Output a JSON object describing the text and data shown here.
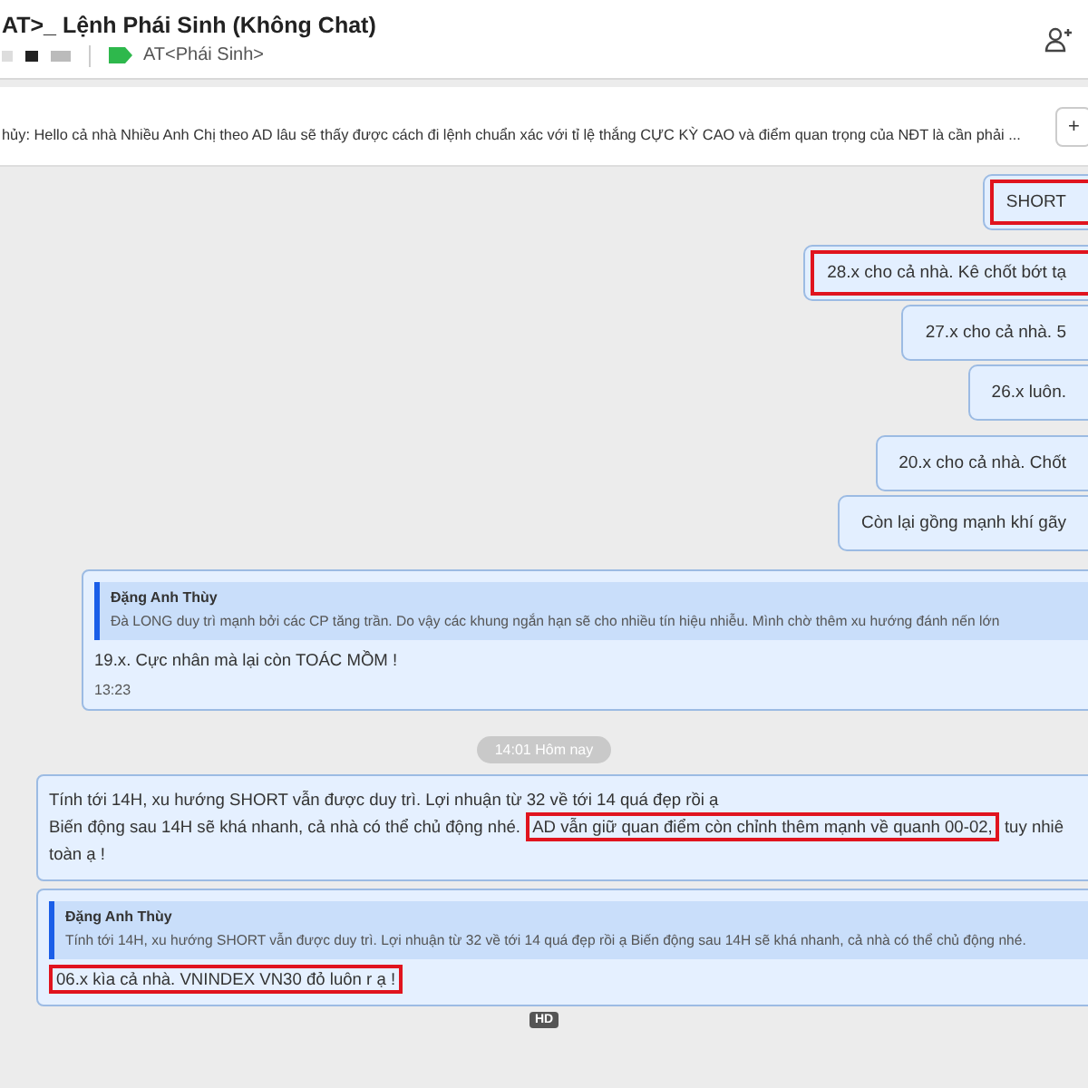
{
  "header": {
    "title": "AT>_ Lệnh Phái Sinh (Không Chat)",
    "tag": "AT<Phái Sinh>"
  },
  "pinned": {
    "text": "hủy: Hello cả nhà Nhiều Anh Chị theo AD lâu sẽ thấy được cách đi lệnh chuẩn xác với tỉ lệ thắng CỰC KỲ CAO và điểm quan trọng của NĐT là cần phải ...",
    "button": "+"
  },
  "messages": [
    {
      "kind": "bubble",
      "text": "SHORT",
      "highlighted": true
    },
    {
      "kind": "bubble",
      "text": "28.x cho cả nhà. Kê chốt bớt tạ",
      "highlighted": true
    },
    {
      "kind": "bubble",
      "text": "27.x cho cả nhà. 5",
      "highlighted": false
    },
    {
      "kind": "bubble",
      "text": "26.x luôn.",
      "highlighted": false
    },
    {
      "kind": "bubble",
      "text": "20.x cho cả nhà. Chốt",
      "highlighted": false
    },
    {
      "kind": "bubble",
      "text": "Còn lại gồng mạnh khí gãy",
      "highlighted": false
    },
    {
      "kind": "card",
      "quote": {
        "author": "Đặng Anh Thùy",
        "text": "Đà LONG duy trì mạnh bởi các CP tăng trần. Do vậy các khung ngắn hạn sẽ cho nhiều tín hiệu nhiễu. Mình chờ thêm xu hướng đánh nến lớn"
      },
      "lines": [
        [
          {
            "text": "19.x. Cực nhân mà lại còn TOÁC MỒM !",
            "highlighted": false
          }
        ]
      ],
      "time": "13:23"
    },
    {
      "kind": "date",
      "text": "14:01 Hôm nay"
    },
    {
      "kind": "card",
      "lines": [
        [
          {
            "text": "Tính tới 14H, xu hướng SHORT vẫn được duy trì. Lợi nhuận từ 32 về tới 14 quá đẹp rồi ạ",
            "highlighted": false
          }
        ],
        [
          {
            "text": "Biến động sau 14H sẽ khá nhanh, cả nhà có thể chủ động nhé.",
            "highlighted": false
          },
          {
            "text": "AD vẫn giữ quan điểm còn chỉnh thêm mạnh về quanh 00-02,",
            "highlighted": true
          },
          {
            "text": "tuy nhiê",
            "highlighted": false
          }
        ],
        [
          {
            "text": "toàn ạ !",
            "highlighted": false
          }
        ]
      ]
    },
    {
      "kind": "card",
      "quote": {
        "author": "Đặng Anh Thùy",
        "text": "Tính tới 14H, xu hướng SHORT vẫn được duy trì. Lợi nhuận từ 32 về tới 14 quá đẹp rồi ạ Biến động sau 14H sẽ khá nhanh, cả nhà có thể chủ động nhé."
      },
      "lines": [
        [
          {
            "text": "06.x kìa cả nhà. VNINDEX VN30 đỏ luôn r ạ !",
            "highlighted": true
          }
        ]
      ]
    },
    {
      "kind": "badge",
      "text": "HD"
    }
  ]
}
